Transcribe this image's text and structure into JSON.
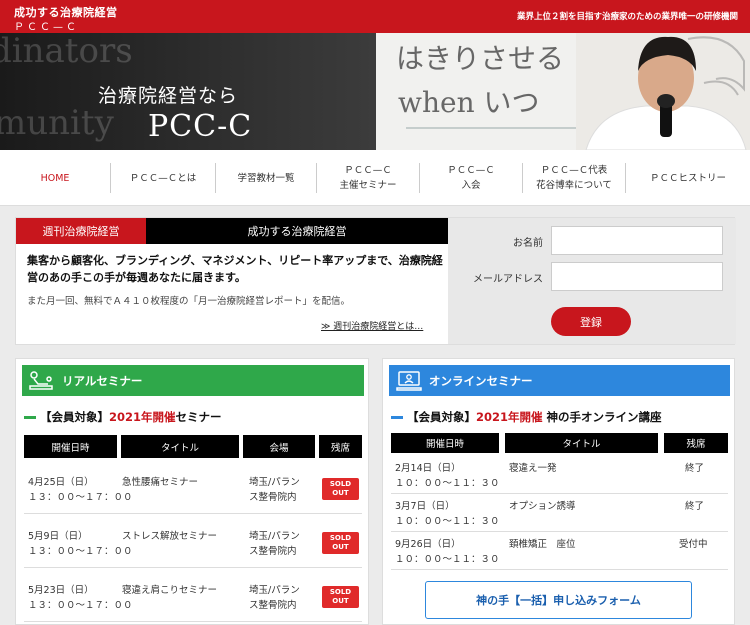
{
  "header": {
    "logo_main": "成功する治療院経営",
    "logo_sub": "ＰＣＣ—Ｃ",
    "tagline": "業界上位２割を目指す治療家のための業界唯一の研修機関",
    "hero_title": "治療院経営なら",
    "hero_brand": "PCC-C",
    "bg_words": [
      "dinators",
      "munity"
    ],
    "whiteboard_texts": [
      "はきりさせる",
      "when いつ"
    ]
  },
  "nav": {
    "items": [
      {
        "label": "HOME",
        "active": true
      },
      {
        "label": "ＰＣＣ—Ｃとは"
      },
      {
        "label": "学習教材一覧"
      },
      {
        "label": "ＰＣＣ—Ｃ\n主催セミナー"
      },
      {
        "label": "ＰＣＣ—Ｃ\n入会"
      },
      {
        "label": "ＰＣＣ—Ｃ代表\n花谷博幸について"
      },
      {
        "label": "ＰＣＣヒストリー"
      }
    ]
  },
  "newsletter": {
    "tab_red": "週刊治療院経営",
    "tab_black": "成功する治療院経営",
    "main_text": "集客から顧客化、ブランディング、マネジメント、リピート率アップまで、治療院経営のあの手この手が毎週あなたに届きます。",
    "sub_text": "また月一回、無料でＡ４１０枚程度の「月一治療院経営レポート」を配信。",
    "link_text": "≫ 週刊治療院経営とは…",
    "name_label": "お名前",
    "email_label": "メールアドレス",
    "submit_label": "登録"
  },
  "real_seminar": {
    "header": "リアルセミナー",
    "title_prefix": "【会員対象】",
    "title_highlight": "2021年開催",
    "title_suffix": "セミナー",
    "columns": [
      "開催日時",
      "タイトル",
      "会場",
      "残席"
    ],
    "rows": [
      {
        "date": "4月25日（日）\n１３：００〜１７：００",
        "title": "急性腰痛セミナー",
        "venue": "埼玉/パラン\nス整骨院内",
        "status": "SOLD\nOUT"
      },
      {
        "date": "5月9日（日）\n１３：００〜１７：００",
        "title": "ストレス解放セミナー",
        "venue": "埼玉/パラン\nス整骨院内",
        "status": "SOLD\nOUT"
      },
      {
        "date": "5月23日（日）\n１３：００〜１７：００",
        "title": "寝違え肩こりセミナー",
        "venue": "埼玉/パラン\nス整骨院内",
        "status": "SOLD\nOUT"
      }
    ]
  },
  "online_seminar": {
    "header": "オンラインセミナー",
    "title_prefix": "【会員対象】",
    "title_highlight": "2021年開催",
    "title_suffix": " 神の手オンライン講座",
    "columns": [
      "開催日時",
      "タイトル",
      "残席"
    ],
    "rows": [
      {
        "date": "2月14日（日）\n１０：００〜１１：３０",
        "title": "寝違え一発",
        "status": "終了"
      },
      {
        "date": "3月7日（日）\n１０：００〜１１：３０",
        "title": "オプション誘導",
        "status": "終了"
      },
      {
        "date": "9月26日（日）\n１０：００〜１１：３０",
        "title": "頚椎矯正　座位",
        "status": "受付中"
      }
    ],
    "apply_button": "神の手【一括】申し込みフォーム"
  },
  "colors": {
    "brand_red": "#c8161d",
    "real_green": "#2fa84a",
    "online_blue": "#2d87dd"
  }
}
